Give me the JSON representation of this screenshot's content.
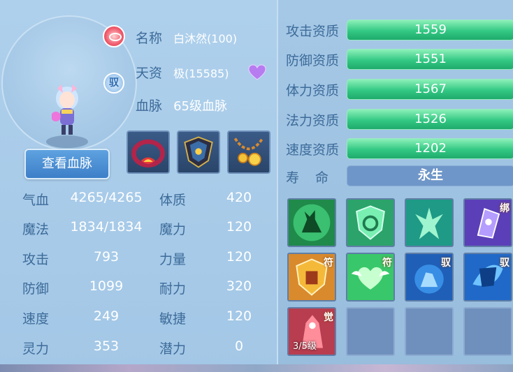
{
  "pet": {
    "name_label": "名称",
    "name_value": "白沐然(100)",
    "talent_label": "天资",
    "talent_value": "极(15585)",
    "bloodline_label": "血脉",
    "bloodline_value": "65级血脉",
    "rider_badge": "驭"
  },
  "buttons": {
    "view_bloodline": "查看血脉"
  },
  "equipment": [
    {
      "icon": "collar-icon"
    },
    {
      "icon": "armor-icon"
    },
    {
      "icon": "amulet-icon"
    }
  ],
  "stats": [
    {
      "label": "气血",
      "value": "4265/4265",
      "attr_label": "体质",
      "attr_value": "420"
    },
    {
      "label": "魔法",
      "value": "1834/1834",
      "attr_label": "魔力",
      "attr_value": "120"
    },
    {
      "label": "攻击",
      "value": "793",
      "attr_label": "力量",
      "attr_value": "120"
    },
    {
      "label": "防御",
      "value": "1099",
      "attr_label": "耐力",
      "attr_value": "320"
    },
    {
      "label": "速度",
      "value": "249",
      "attr_label": "敏捷",
      "attr_value": "120"
    },
    {
      "label": "灵力",
      "value": "353",
      "attr_label": "潜力",
      "attr_value": "0"
    }
  ],
  "qualities": [
    {
      "label": "攻击资质",
      "value": "1559"
    },
    {
      "label": "防御资质",
      "value": "1551"
    },
    {
      "label": "体力资质",
      "value": "1567"
    },
    {
      "label": "法力资质",
      "value": "1526"
    },
    {
      "label": "速度资质",
      "value": "1202"
    }
  ],
  "life": {
    "label": "寿　命",
    "value": "永生"
  },
  "skills": [
    {
      "icon": "deer-skill-icon",
      "tag": ""
    },
    {
      "icon": "shield-swirl-skill-icon",
      "tag": ""
    },
    {
      "icon": "jade-figure-skill-icon",
      "tag": ""
    },
    {
      "icon": "purple-crystal-skill-icon",
      "tag": "绑"
    },
    {
      "icon": "golden-shield-skill-icon",
      "tag": "符"
    },
    {
      "icon": "heart-wings-skill-icon",
      "tag": "符"
    },
    {
      "icon": "blue-rider-skill-icon",
      "tag": "驭"
    },
    {
      "icon": "blue-shield-skill-icon",
      "tag": "驭"
    },
    {
      "icon": "red-beast-skill-icon",
      "tag": "觉",
      "level": "3/5级"
    },
    {
      "icon": "",
      "tag": ""
    },
    {
      "icon": "",
      "tag": ""
    },
    {
      "icon": "",
      "tag": ""
    }
  ],
  "colors": {
    "accent_green": "#33c884",
    "label_blue": "#3d6b99",
    "button_blue": "#3c7fc8"
  }
}
